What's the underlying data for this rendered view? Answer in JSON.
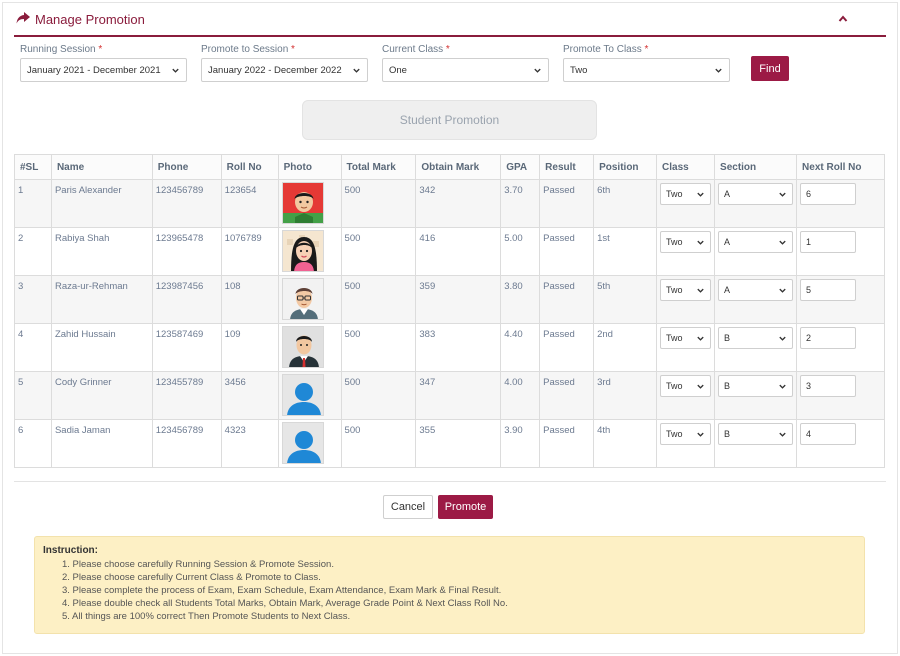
{
  "header": {
    "title": "Manage Promotion"
  },
  "filters": {
    "running_session": {
      "label": "Running Session",
      "value": "January 2021 - December 2021"
    },
    "promote_session": {
      "label": "Promote to Session",
      "value": "January 2022 - December 2022"
    },
    "current_class": {
      "label": "Current Class",
      "value": "One"
    },
    "promote_class": {
      "label": "Promote To Class",
      "value": "Two"
    },
    "required_mark": "*",
    "find_label": "Find"
  },
  "promotion_title": "Student Promotion",
  "table": {
    "headers": [
      "#SL",
      "Name",
      "Phone",
      "Roll No",
      "Photo",
      "Total Mark",
      "Obtain Mark",
      "GPA",
      "Result",
      "Position",
      "Class",
      "Section",
      "Next Roll No"
    ],
    "rows": [
      {
        "sl": "1",
        "name": "Paris Alexander",
        "phone": "123456789",
        "roll": "123654",
        "photo": "avatar-green-shirt",
        "total": "500",
        "obtain": "342",
        "gpa": "3.70",
        "result": "Passed",
        "position": "6th",
        "class": "Two",
        "section": "A",
        "next_roll": "6"
      },
      {
        "sl": "2",
        "name": "Rabiya Shah",
        "phone": "123965478",
        "roll": "1076789",
        "photo": "avatar-woman",
        "total": "500",
        "obtain": "416",
        "gpa": "5.00",
        "result": "Passed",
        "position": "1st",
        "class": "Two",
        "section": "A",
        "next_roll": "1"
      },
      {
        "sl": "3",
        "name": "Raza-ur-Rehman",
        "phone": "123987456",
        "roll": "108",
        "photo": "avatar-glasses",
        "total": "500",
        "obtain": "359",
        "gpa": "3.80",
        "result": "Passed",
        "position": "5th",
        "class": "Two",
        "section": "A",
        "next_roll": "5"
      },
      {
        "sl": "4",
        "name": "Zahid Hussain",
        "phone": "123587469",
        "roll": "109",
        "photo": "avatar-suit",
        "total": "500",
        "obtain": "383",
        "gpa": "4.40",
        "result": "Passed",
        "position": "2nd",
        "class": "Two",
        "section": "B",
        "next_roll": "2"
      },
      {
        "sl": "5",
        "name": "Cody Grinner",
        "phone": "123455789",
        "roll": "3456",
        "photo": "avatar-placeholder",
        "total": "500",
        "obtain": "347",
        "gpa": "4.00",
        "result": "Passed",
        "position": "3rd",
        "class": "Two",
        "section": "B",
        "next_roll": "3"
      },
      {
        "sl": "6",
        "name": "Sadia Jaman",
        "phone": "123456789",
        "roll": "4323",
        "photo": "avatar-placeholder",
        "total": "500",
        "obtain": "355",
        "gpa": "3.90",
        "result": "Passed",
        "position": "4th",
        "class": "Two",
        "section": "B",
        "next_roll": "4"
      }
    ]
  },
  "actions": {
    "cancel_label": "Cancel",
    "promote_label": "Promote"
  },
  "instruction": {
    "title": "Instruction:",
    "items": [
      "1. Please choose carefully Running Session & Promote Session.",
      "2. Please choose carefully Current Class & Promote to Class.",
      "3. Please complete the process of Exam, Exam Schedule, Exam Attendance, Exam Mark & Final Result.",
      "4. Please double check all Students Total Marks, Obtain Mark, Average Grade Point & Next Class Roll No.",
      "5. All things are 100% correct Then Promote Students to Next Class."
    ]
  },
  "colors": {
    "brand": "#9c1a45",
    "header_accent": "#8a1c3c",
    "instruction_bg": "#fdf0c5"
  },
  "icons": {
    "header": "share-arrow-icon",
    "collapse": "chevron-up-icon",
    "select": "chevron-down-icon"
  }
}
